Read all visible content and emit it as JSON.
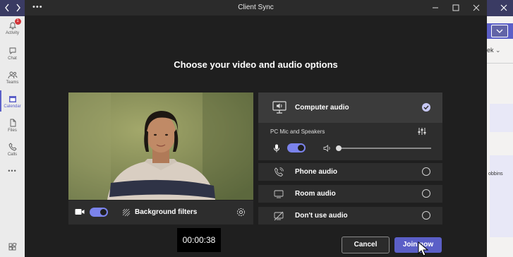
{
  "window": {
    "title": "Client Sync"
  },
  "rail": {
    "items": [
      {
        "label": "Activity",
        "icon": "bell-icon",
        "badge": "1"
      },
      {
        "label": "Chat",
        "icon": "chat-icon"
      },
      {
        "label": "Teams",
        "icon": "teams-icon"
      },
      {
        "label": "Calendar",
        "icon": "calendar-icon"
      },
      {
        "label": "Files",
        "icon": "file-icon"
      },
      {
        "label": "Calls",
        "icon": "phone-icon"
      }
    ],
    "more": "•••"
  },
  "background_app": {
    "week_text": "ek",
    "robbins_text": "obbins"
  },
  "main": {
    "heading": "Choose your video and audio options",
    "video_bar": {
      "background_filters": "Background filters"
    },
    "timer": "00:00:38"
  },
  "audio": {
    "computer_audio": "Computer audio",
    "device_label": "PC Mic and Speakers",
    "speaker_volume": 0.0,
    "phone_audio": "Phone audio",
    "room_audio": "Room audio",
    "dont_use_audio": "Don't use audio"
  },
  "buttons": {
    "cancel": "Cancel",
    "join_now": "Join now"
  },
  "colors": {
    "accent": "#7b83eb",
    "title_strip": "#3a3b63",
    "badge": "#d13438"
  }
}
